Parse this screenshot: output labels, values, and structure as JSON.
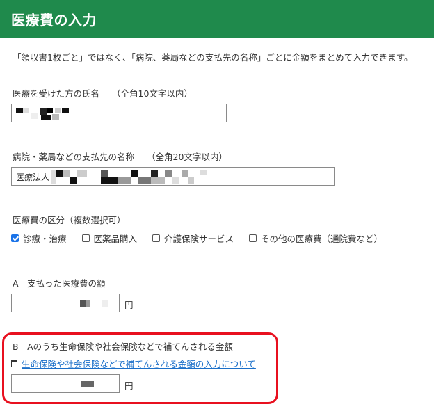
{
  "header": {
    "title": "医療費の入力"
  },
  "intro": "「領収書1枚ごと」ではなく、「病院、薬局などの支払先の名称」ごとに金額をまとめて入力できます。",
  "patient": {
    "label": "医療を受けた方の氏名",
    "note": "（全角10文字以内）",
    "value": "[redacted]"
  },
  "payee": {
    "label": "病院・薬局などの支払先の名称",
    "note": "（全角20文字以内）",
    "value_prefix": "医療法人",
    "value": "[redacted]"
  },
  "category": {
    "label": "医療費の区分（複数選択可）",
    "options": [
      {
        "label": "診療・治療",
        "checked": true
      },
      {
        "label": "医薬品購入",
        "checked": false
      },
      {
        "label": "介護保険サービス",
        "checked": false
      },
      {
        "label": "その他の医療費（通院費など）",
        "checked": false
      }
    ]
  },
  "amount_a": {
    "label": "A　支払った医療費の額",
    "value": "[redacted]",
    "unit": "円"
  },
  "amount_b": {
    "label": "B　Aのうち生命保険や社会保険などで補てんされる金額",
    "link_text": "生命保険や社会保険などで補てんされる金額の入力について",
    "value": "[redacted]",
    "unit": "円"
  },
  "colors": {
    "header_bg": "#1f8a4c",
    "highlight_border": "#e8101f",
    "link": "#1a6fc9",
    "checkbox_checked": "#1a73e8"
  },
  "icons": {
    "link_icon": "document-icon",
    "checkbox_checked_icon": "checkmark-icon"
  }
}
